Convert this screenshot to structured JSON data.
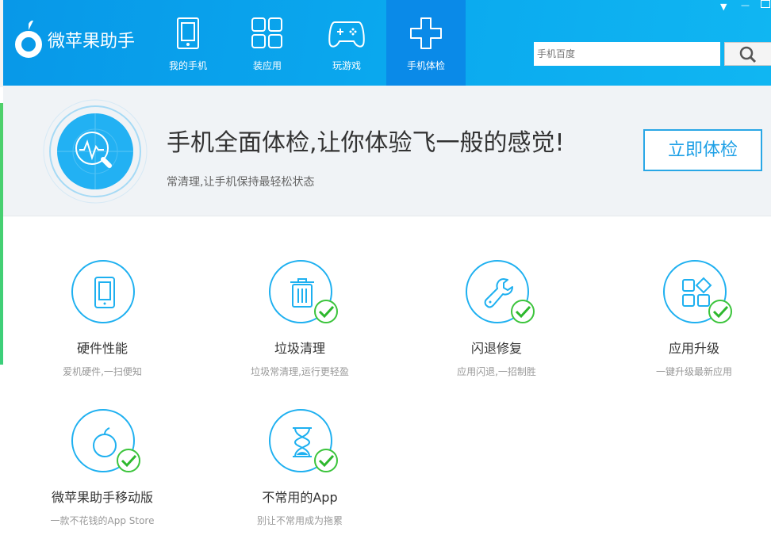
{
  "app": {
    "name": "微苹果助手"
  },
  "tabs": [
    {
      "label": "我的手机",
      "icon": "tablet-icon"
    },
    {
      "label": "装应用",
      "icon": "apps-grid-icon"
    },
    {
      "label": "玩游戏",
      "icon": "gamepad-icon"
    },
    {
      "label": "手机体检",
      "icon": "plus-cross-icon",
      "active": true
    }
  ],
  "search": {
    "placeholder": "手机百度"
  },
  "banner": {
    "title": "手机全面体检,让你体验飞一般的感觉!",
    "subtitle": "常清理,让手机保持最轻松状态",
    "button": "立即体检"
  },
  "features": [
    {
      "title": "硬件性能",
      "desc": "爱机硬件,一扫便知",
      "icon": "phone-icon",
      "checked": false
    },
    {
      "title": "垃圾清理",
      "desc": "垃圾常清理,运行更轻盈",
      "icon": "trash-icon",
      "checked": true
    },
    {
      "title": "闪退修复",
      "desc": "应用闪退,一招制胜",
      "icon": "wrench-icon",
      "checked": true
    },
    {
      "title": "应用升级",
      "desc": "一键升级最新应用",
      "icon": "apps-icon",
      "checked": true
    },
    {
      "title": "微苹果助手移动版",
      "desc": "一款不花钱的App Store",
      "icon": "apple-icon",
      "checked": true
    },
    {
      "title": "不常用的App",
      "desc": "别让不常用成为拖累",
      "icon": "hourglass-icon",
      "checked": true
    }
  ],
  "colors": {
    "header": "#0aa8ee",
    "accent": "#1eb0f0",
    "check": "#3bc43b"
  }
}
